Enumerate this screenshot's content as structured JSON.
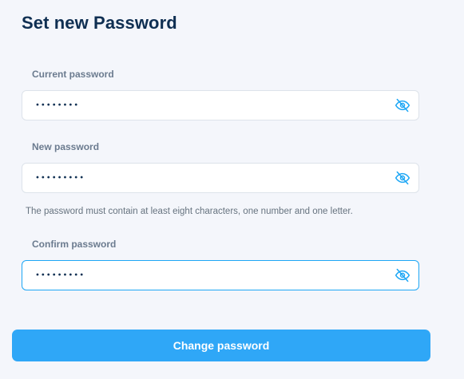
{
  "title": "Set new Password",
  "fields": [
    {
      "label": "Current password",
      "masked_value": "••••••••",
      "toggle_icon": "eye-off-icon"
    },
    {
      "label": "New password",
      "masked_value": "•••••••••",
      "toggle_icon": "eye-off-icon"
    },
    {
      "label": "Confirm password",
      "masked_value": "•••••••••",
      "toggle_icon": "eye-off-icon"
    }
  ],
  "hint": "The password must contain at least eight characters, one number and one letter.",
  "submit_label": "Change password",
  "colors": {
    "accent": "#2fa7f7",
    "focus_border": "#1ea7f5",
    "title": "#0f2f52",
    "label": "#6b7b8f",
    "background": "#f4f6fb"
  }
}
